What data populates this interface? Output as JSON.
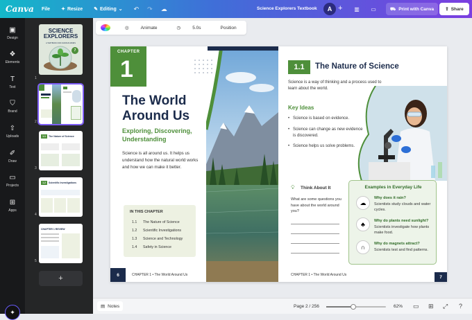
{
  "topbar": {
    "logo": "Canva",
    "file_label": "File",
    "resize_label": "Resize",
    "editing_label": "Editing",
    "doc_title": "Science Explorers Textbook",
    "avatar_initial": "A",
    "print_label": "Print with Canva",
    "share_label": "Share"
  },
  "rail": [
    {
      "label": "Design",
      "icon": "layout-icon"
    },
    {
      "label": "Elements",
      "icon": "shapes-icon"
    },
    {
      "label": "Text",
      "icon": "text-icon"
    },
    {
      "label": "Brand",
      "icon": "brand-icon"
    },
    {
      "label": "Uploads",
      "icon": "cloud-upload-icon"
    },
    {
      "label": "Draw",
      "icon": "pen-icon"
    },
    {
      "label": "Projects",
      "icon": "folder-icon"
    },
    {
      "label": "Apps",
      "icon": "apps-icon"
    }
  ],
  "pages_panel": {
    "cover_title": "SCIENCE EXPLORERS",
    "cover_subtitle": "A TEXTBOOK FOR CURIOUS MINDS",
    "cover_badge": "7",
    "numbers": [
      "1",
      "2",
      "3",
      "4",
      "5"
    ],
    "thumb3_badge": "1.1",
    "thumb3_title": "The Nature of Science",
    "thumb4_badge": "1.2",
    "thumb4_title": "Scientific Investigations",
    "thumb5_title": "CHAPTER 1 REVIEW",
    "add_page": "+"
  },
  "toolbar": {
    "animate_label": "Animate",
    "duration_label": "5.0s",
    "position_label": "Position"
  },
  "left_page": {
    "chapter_label": "CHAPTER",
    "chapter_number": "1",
    "title_line1": "The World",
    "title_line2": "Around Us",
    "subtitle_line1": "Exploring, Discovering,",
    "subtitle_line2": "Understanding",
    "body": "Science is all around us. It helps us understand how the natural world works and how we can make it better.",
    "in_chapter_heading": "IN THIS CHAPTER",
    "in_chapter": [
      {
        "num": "1.1",
        "title": "The Nature of Science"
      },
      {
        "num": "1.2",
        "title": "Scientific Investigations"
      },
      {
        "num": "1.3",
        "title": "Science and Technology"
      },
      {
        "num": "1.4",
        "title": "Safety in Science"
      }
    ],
    "page_number": "6",
    "footer": "CHAPTER 1  •  The World Around Us"
  },
  "right_page": {
    "section_number": "1.1",
    "section_title": "The Nature of Science",
    "intro": "Science is a way of thinking and a process used to learn about the world.",
    "key_ideas_heading": "Key Ideas",
    "key_ideas": [
      "Science is based on evidence.",
      "Science can change as new evidence is discovered.",
      "Science helps us solve problems."
    ],
    "think_heading": "Think About It",
    "think_body": "What are some questions you have about the world around you?",
    "examples_heading": "Examples in Everyday Life",
    "examples": [
      {
        "q": "Why does it rain?",
        "a": "Scientists study clouds and water cycles.",
        "icon": "cloud-icon"
      },
      {
        "q": "Why do plants need sunlight?",
        "a": "Scientists investigate how plants make food.",
        "icon": "plant-icon"
      },
      {
        "q": "Why do magnets attract?",
        "a": "Scientists test and find patterns.",
        "icon": "magnet-icon"
      }
    ],
    "footer": "CHAPTER 1  •  The World Around Us",
    "page_number": "7"
  },
  "bottombar": {
    "notes_label": "Notes",
    "page_info": "Page 2 / 256",
    "zoom_label": "62%",
    "zoom_fraction": 0.45
  }
}
